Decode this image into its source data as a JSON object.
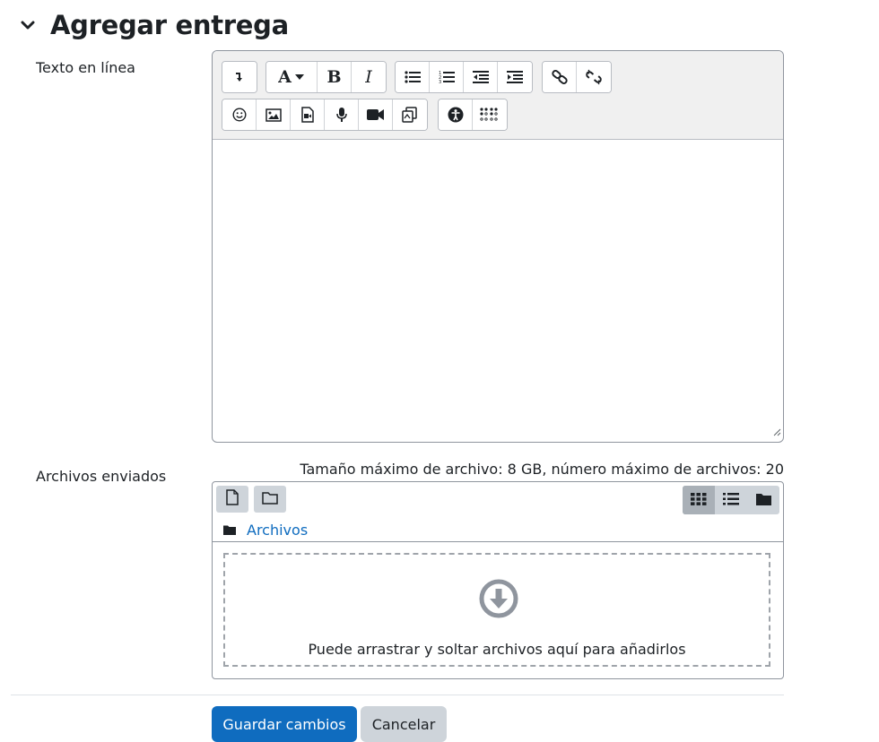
{
  "section": {
    "title": "Agregar entrega",
    "collapse_icon": "chevron-down-icon"
  },
  "online_text": {
    "label": "Texto en línea",
    "toolbar_row1": [
      "collapse-icon",
      "font-style-icon",
      "bold-icon",
      "italic-icon",
      "unordered-list-icon",
      "ordered-list-icon",
      "outdent-icon",
      "indent-icon",
      "link-icon",
      "unlink-icon"
    ],
    "toolbar_row2": [
      "emoji-icon",
      "image-icon",
      "media-icon",
      "record-audio-icon",
      "record-video-icon",
      "manage-files-icon",
      "accessibility-checker-icon",
      "screenreader-helper-icon"
    ],
    "bold_glyph": "B",
    "italic_glyph": "I",
    "font_glyph": "A"
  },
  "files": {
    "label": "Archivos enviados",
    "limits": "Tamaño máximo de archivo: 8 GB, número máximo de archivos: 20",
    "breadcrumb": "Archivos",
    "dropzone_text": "Puede arrastrar y soltar archivos aquí para añadirlos",
    "active_view": "icons"
  },
  "actions": {
    "save": "Guardar cambios",
    "cancel": "Cancelar"
  },
  "colors": {
    "primary": "#0f6cbf",
    "secondary": "#ced4da",
    "link": "#0f6cbf"
  }
}
